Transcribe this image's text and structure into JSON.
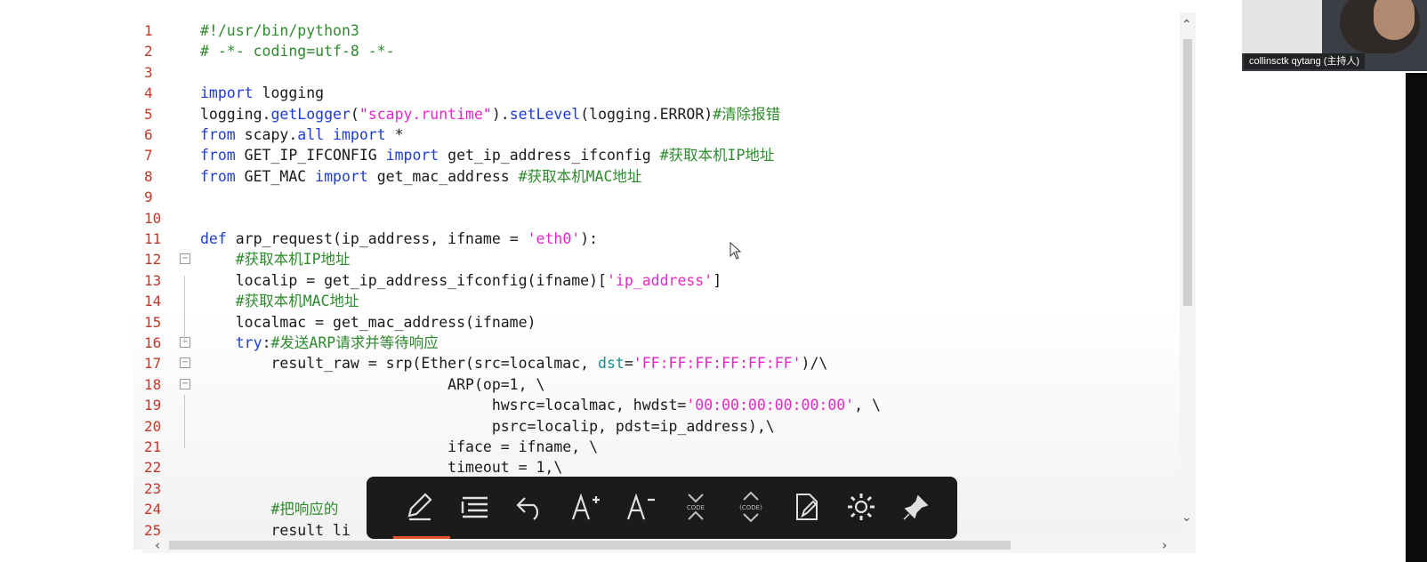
{
  "editor": {
    "lines": [
      {
        "n": "1",
        "html": "<span class=\"com\">#!/usr/bin/python3</span>",
        "indent": 0
      },
      {
        "n": "2",
        "html": "<span class=\"com\"># -*- coding=utf-8 -*-</span>",
        "indent": 0
      },
      {
        "n": "3",
        "html": "",
        "indent": 0
      },
      {
        "n": "4",
        "html": "<span class=\"kw\">import</span> logging",
        "indent": 0
      },
      {
        "n": "5",
        "html": "logging.<span class=\"fn\">getLogger</span>(<span class=\"str\">\"scapy.runtime\"</span>).<span class=\"fn\">setLevel</span>(logging.ERROR)<span class=\"com\">#清除报错</span>",
        "indent": 0
      },
      {
        "n": "6",
        "html": "<span class=\"kw\">from</span> scapy.<span class=\"fn\">all</span> <span class=\"kw\">import</span> *",
        "indent": 0
      },
      {
        "n": "7",
        "html": "<span class=\"kw\">from</span> GET_IP_IFCONFIG <span class=\"kw\">import</span> get_ip_address_ifconfig <span class=\"com\">#获取本机IP地址</span>",
        "indent": 0
      },
      {
        "n": "8",
        "html": "<span class=\"kw\">from</span> GET_MAC <span class=\"kw\">import</span> get_mac_address <span class=\"com\">#获取本机MAC地址</span>",
        "indent": 0
      },
      {
        "n": "9",
        "html": "",
        "indent": 0
      },
      {
        "n": "10",
        "html": "",
        "indent": 0
      },
      {
        "n": "11",
        "html": "<span class=\"kw\">def</span> arp_request(ip_address, ifname = <span class=\"str\">'eth0'</span>):",
        "indent": 0
      },
      {
        "n": "12",
        "html": "    <span class=\"com\">#获取本机IP地址</span>",
        "indent": 0,
        "fold": true
      },
      {
        "n": "13",
        "html": "    localip = get_ip_address_ifconfig(ifname)[<span class=\"str\">'ip_address'</span>]",
        "indent": 0
      },
      {
        "n": "14",
        "html": "    <span class=\"com\">#获取本机MAC地址</span>",
        "indent": 0
      },
      {
        "n": "15",
        "html": "    localmac = get_mac_address(ifname)",
        "indent": 0
      },
      {
        "n": "16",
        "html": "    <span class=\"kw\">try</span>:<span class=\"com\">#发送ARP请求并等待响应</span>",
        "indent": 0,
        "fold": true
      },
      {
        "n": "17",
        "html": "        result_raw = srp(Ether(src=localmac, <span class=\"par\">dst</span>=<span class=\"str\">'FF:FF:FF:FF:FF:FF'</span>)/\\",
        "indent": 0,
        "fold": true
      },
      {
        "n": "18",
        "html": "                            ARP(op=1, \\",
        "indent": 0,
        "fold": true
      },
      {
        "n": "19",
        "html": "                                 hwsrc=localmac, hwdst=<span class=\"str\">'00:00:00:00:00:00'</span>, \\",
        "indent": 0
      },
      {
        "n": "20",
        "html": "                                 psrc=localip, pdst=ip_address),\\",
        "indent": 0
      },
      {
        "n": "21",
        "html": "                            iface = ifname, \\",
        "indent": 0
      },
      {
        "n": "22",
        "html": "                            timeout = 1,\\",
        "indent": 0
      },
      {
        "n": "23",
        "html": "",
        "indent": 0
      },
      {
        "n": "24",
        "html": "        <span class=\"com\">#把响应的</span>",
        "indent": 0
      },
      {
        "n": "25",
        "html": "        result_li",
        "indent": 0
      }
    ]
  },
  "webcam": {
    "label": "collinsctk qytang (主持人)"
  },
  "toolbar": {
    "buttons": [
      "pencil-icon",
      "list-icon",
      "undo-icon",
      "font-increase-icon",
      "font-decrease-icon",
      "collapse-code-icon",
      "expand-code-icon",
      "note-icon",
      "gear-icon",
      "pin-icon"
    ]
  }
}
